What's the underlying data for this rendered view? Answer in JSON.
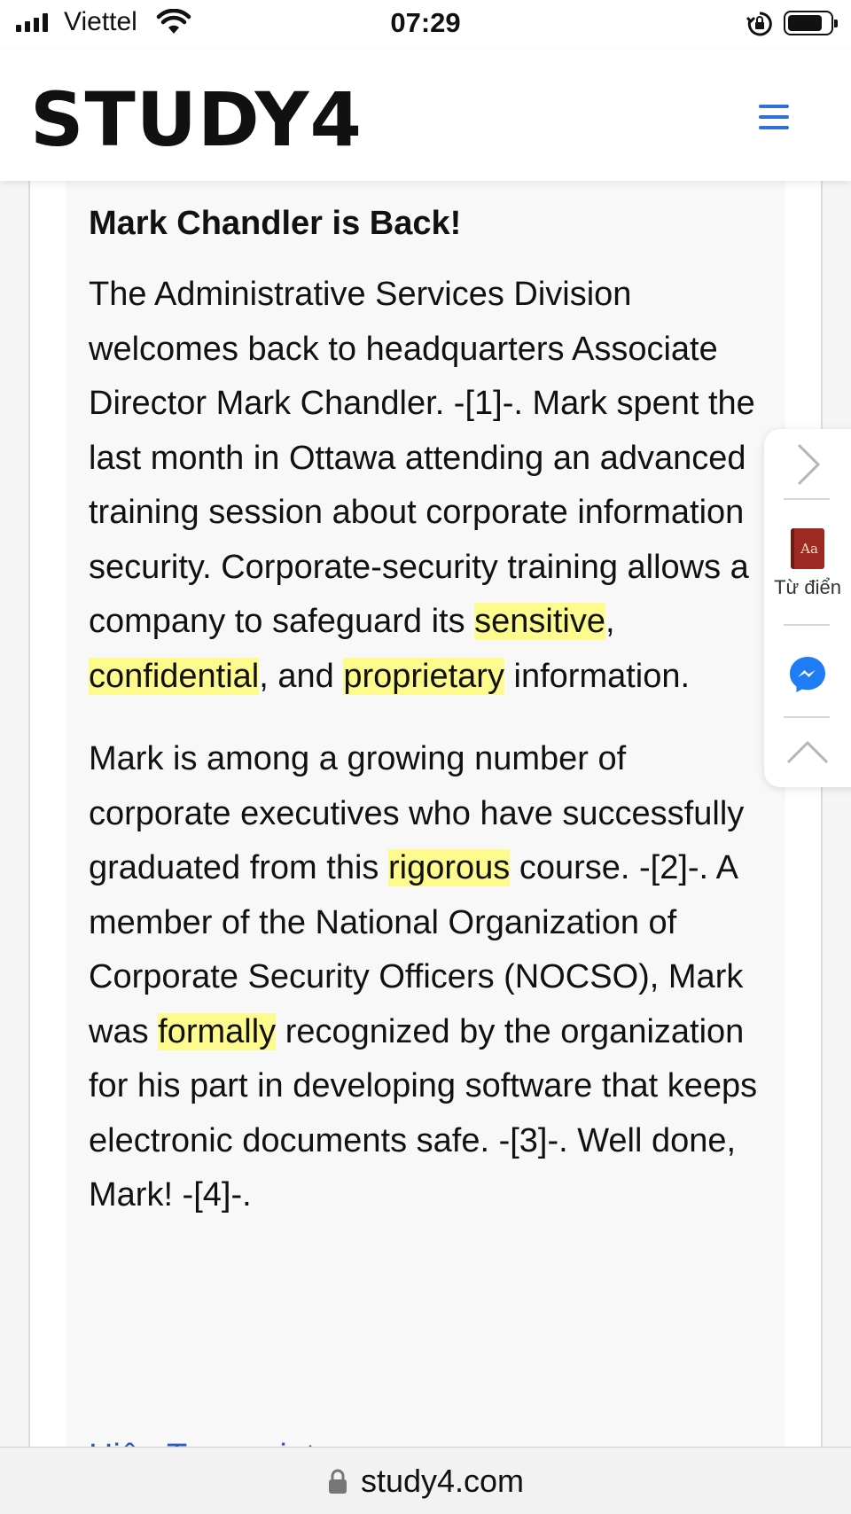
{
  "status_bar": {
    "carrier": "Viettel",
    "time": "07:29"
  },
  "header": {
    "logo": "STUDY4",
    "menu_icon": "hamburger-menu-icon",
    "menu_color": "#2e6fd8"
  },
  "article": {
    "title": "Mark Chandler is Back!",
    "paragraph1": {
      "part1": "The Administrative Services Division welcomes back to headquarters Associate Director Mark Chandler. -[1]-. Mark spent the last month in Ottawa attending an advanced training session about corporate information security. Corporate-security training allows a company to safeguard its ",
      "hl1": "sensitive",
      "part2": ", ",
      "hl2": "confidential",
      "part3": ", and ",
      "hl3": "proprietary",
      "part4": " information."
    },
    "paragraph2": {
      "part1": "Mark is among a growing number of corporate executives who have successfully graduated from this ",
      "hl1": "rigorous",
      "part2": " course. -[2]-. A member of the National Organization of Corporate Security Officers (NOCSO), Mark was ",
      "hl2": "formally",
      "part3": " recognized by the organization for his part in developing software that keeps electronic documents safe. -[3]-. Well done, Mark! -[4]-."
    },
    "highlight_color": "#fdfa8e",
    "partial_link": "Hiện Transcript"
  },
  "side_widget": {
    "next_icon": "chevron-right-icon",
    "dictionary_label": "Từ điển",
    "dictionary_icon_text": "Aa",
    "messenger_icon": "messenger-icon",
    "up_icon": "chevron-up-icon"
  },
  "url_bar": {
    "url": "study4.com",
    "lock_icon": "lock-icon"
  }
}
